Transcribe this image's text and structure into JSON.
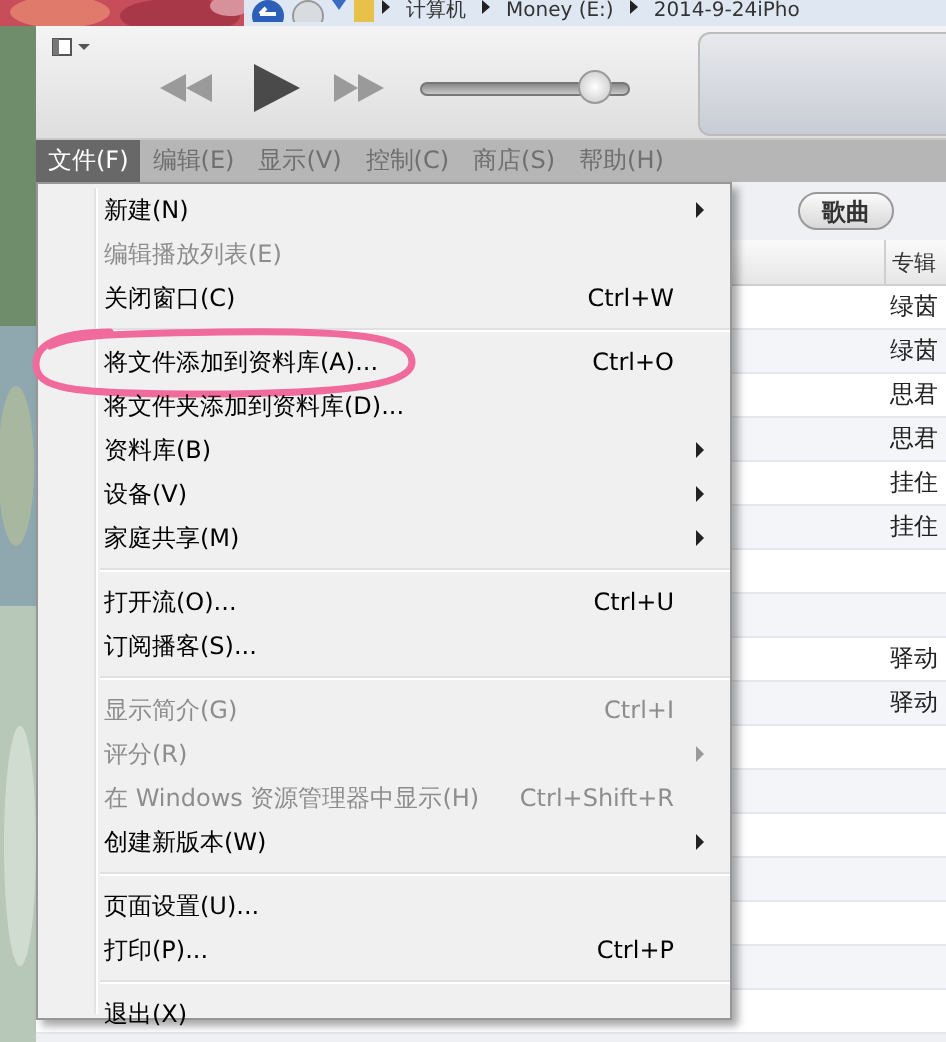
{
  "explorer_bar": {
    "breadcrumbs": [
      "计算机",
      "Money (E:)",
      "2014-9-24iPho"
    ]
  },
  "toolbar": {
    "volume": {
      "level": 0.9
    }
  },
  "menu_bar": [
    {
      "label": "文件(F)",
      "selected": true
    },
    {
      "label": "编辑(E)",
      "selected": false
    },
    {
      "label": "显示(V)",
      "selected": false
    },
    {
      "label": "控制(C)",
      "selected": false
    },
    {
      "label": "商店(S)",
      "selected": false
    },
    {
      "label": "帮助(H)",
      "selected": false
    }
  ],
  "content": {
    "view_button": "歌曲",
    "column_header": "专辑",
    "rows": [
      {
        "album": "绿茵"
      },
      {
        "album": "绿茵"
      },
      {
        "album": "思君"
      },
      {
        "album": "思君"
      },
      {
        "album": "挂住"
      },
      {
        "album": "挂住"
      },
      {},
      {},
      {
        "album": "驿动"
      },
      {
        "album": "驿动"
      },
      {},
      {},
      {},
      {},
      {},
      {},
      {}
    ]
  },
  "file_menu": [
    {
      "kind": "item",
      "label": "新建(N)",
      "submenu": true,
      "disabled": false
    },
    {
      "kind": "item",
      "label": "编辑播放列表(E)",
      "disabled": true
    },
    {
      "kind": "item",
      "label": "关闭窗口(C)",
      "shortcut": "Ctrl+W",
      "disabled": false
    },
    {
      "kind": "separator"
    },
    {
      "kind": "item",
      "label": "将文件添加到资料库(A)...",
      "shortcut": "Ctrl+O",
      "disabled": false,
      "circled": true
    },
    {
      "kind": "item",
      "label": "将文件夹添加到资料库(D)...",
      "disabled": false
    },
    {
      "kind": "item",
      "label": "资料库(B)",
      "submenu": true,
      "disabled": false
    },
    {
      "kind": "item",
      "label": "设备(V)",
      "submenu": true,
      "disabled": false
    },
    {
      "kind": "item",
      "label": "家庭共享(M)",
      "submenu": true,
      "disabled": false
    },
    {
      "kind": "separator"
    },
    {
      "kind": "item",
      "label": "打开流(O)...",
      "shortcut": "Ctrl+U",
      "disabled": false
    },
    {
      "kind": "item",
      "label": "订阅播客(S)...",
      "disabled": false
    },
    {
      "kind": "separator"
    },
    {
      "kind": "item",
      "label": "显示简介(G)",
      "shortcut": "Ctrl+I",
      "disabled": true
    },
    {
      "kind": "item",
      "label": "评分(R)",
      "submenu": true,
      "disabled": true
    },
    {
      "kind": "item",
      "label": "在 Windows 资源管理器中显示(H)",
      "shortcut": "Ctrl+Shift+R",
      "disabled": true
    },
    {
      "kind": "item",
      "label": "创建新版本(W)",
      "submenu": true,
      "disabled": false
    },
    {
      "kind": "separator"
    },
    {
      "kind": "item",
      "label": "页面设置(U)...",
      "disabled": false
    },
    {
      "kind": "item",
      "label": "打印(P)...",
      "shortcut": "Ctrl+P",
      "disabled": false
    },
    {
      "kind": "separator"
    },
    {
      "kind": "item",
      "label": "退出(X)",
      "disabled": false
    }
  ]
}
